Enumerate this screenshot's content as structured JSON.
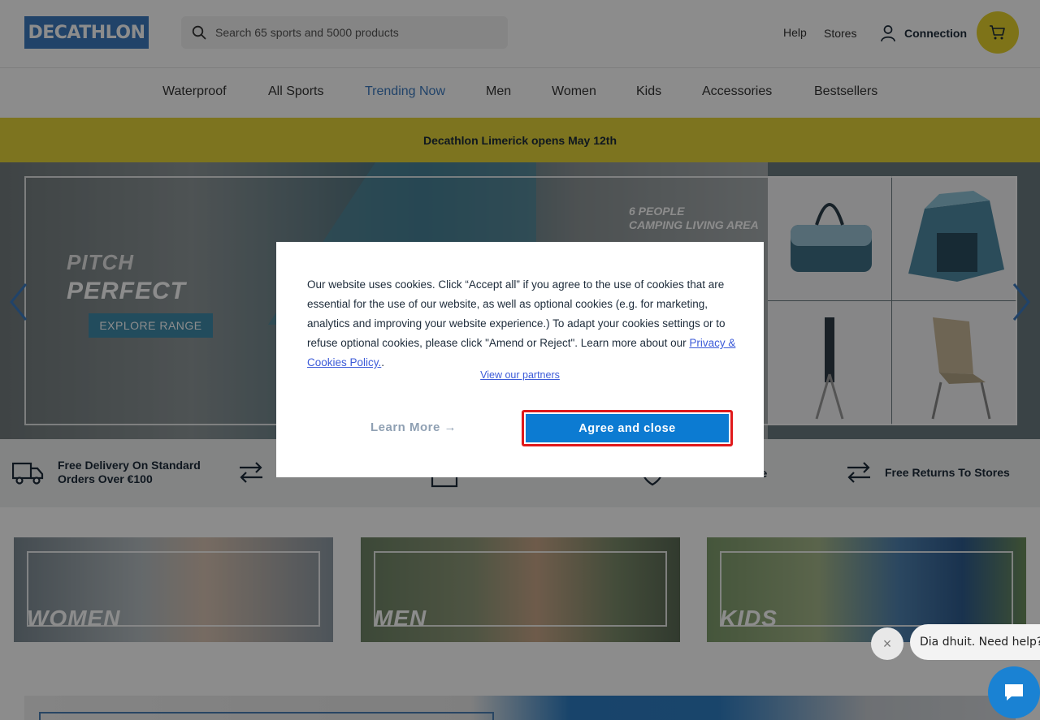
{
  "header": {
    "logo": "DECATHLON",
    "search_placeholder": "Search 65 sports and 5000 products",
    "help": "Help",
    "stores": "Stores",
    "connection": "Connection"
  },
  "nav": {
    "items": [
      {
        "label": "Waterproof",
        "active": false
      },
      {
        "label": "All Sports",
        "active": false
      },
      {
        "label": "Trending Now",
        "active": true
      },
      {
        "label": "Men",
        "active": false
      },
      {
        "label": "Women",
        "active": false
      },
      {
        "label": "Kids",
        "active": false
      },
      {
        "label": "Accessories",
        "active": false
      },
      {
        "label": "Bestsellers",
        "active": false
      }
    ]
  },
  "announcement": "Decathlon Limerick opens May 12th",
  "hero": {
    "pitch": "PITCH",
    "perfect": "PERFECT",
    "explore": "EXPLORE RANGE",
    "six_people_line1": "6 PEOPLE",
    "six_people_line2": "CAMPING LIVING AREA"
  },
  "features": {
    "delivery_line1": "Free Delivery On Standard",
    "delivery_line2": "Orders Over €100",
    "guarantee_suffix": "tee",
    "returns": "Free Returns To Stores"
  },
  "categories": {
    "women": "WOMEN",
    "men": "MEN",
    "kids": "KIDS"
  },
  "cookie": {
    "text_before_link": "Our website uses cookies. Click “Accept all” if you agree to the use of cookies that are essential for the use of our website, as well as optional cookies (e.g. for marketing, analytics and improving your website experience.) To adapt your cookies settings or to refuse optional cookies, please click \"Amend or Reject\". Learn more about our ",
    "policy_link": "Privacy & Cookies Policy.",
    "text_after_link": ".",
    "partners": "View our partners",
    "learn_more": "Learn More →",
    "agree": "Agree and close"
  },
  "chat": {
    "greeting": "Dia dhuit. Need help?",
    "close": "×"
  },
  "colors": {
    "brand_blue": "#3c7ac0",
    "yellow": "#e3d43a",
    "agree_blue": "#0c7bd2",
    "highlight_red": "#e0191b"
  }
}
